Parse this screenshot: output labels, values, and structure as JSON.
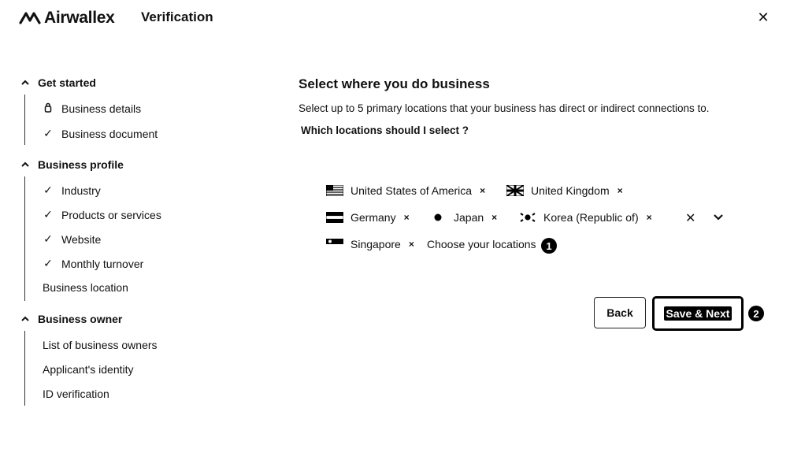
{
  "header": {
    "brand": "Airwallex",
    "title": "Verification",
    "close_icon": "close-icon"
  },
  "sidebar": {
    "sections": [
      {
        "title": "Get started",
        "items": [
          {
            "label": "Business details",
            "icon": "lock-icon"
          },
          {
            "label": "Business document",
            "icon": "check-icon"
          }
        ]
      },
      {
        "title": "Business profile",
        "items": [
          {
            "label": "Industry",
            "icon": "check-icon"
          },
          {
            "label": "Products or services",
            "icon": "check-icon"
          },
          {
            "label": "Website",
            "icon": "check-icon"
          },
          {
            "label": "Monthly turnover",
            "icon": "check-icon"
          },
          {
            "label": "Business location",
            "icon": ""
          }
        ]
      },
      {
        "title": "Business owner",
        "items": [
          {
            "label": "List of business owners",
            "icon": ""
          },
          {
            "label": "Applicant's identity",
            "icon": ""
          },
          {
            "label": "ID verification",
            "icon": ""
          }
        ]
      }
    ]
  },
  "main": {
    "title": "Select where you do business",
    "description": "Select up to 5 primary locations that your business has direct or indirect connections to.",
    "help_link": "Which locations should I select ?",
    "selected_locations": [
      {
        "label": "United States of America",
        "flag": "us-flag-icon"
      },
      {
        "label": "United Kingdom",
        "flag": "uk-flag-icon"
      },
      {
        "label": "Germany",
        "flag": "germany-flag-icon"
      },
      {
        "label": "Japan",
        "flag": "japan-flag-icon"
      },
      {
        "label": "Korea (Republic of)",
        "flag": "korea-flag-icon"
      },
      {
        "label": "Singapore",
        "flag": "singapore-flag-icon"
      }
    ],
    "remove_symbol": "×",
    "placeholder": "Choose your locations",
    "clear_symbol": "✕",
    "dropdown_symbol": "⌄",
    "back_label": "Back",
    "save_label": "Save & Next",
    "annotations": [
      "1",
      "2"
    ]
  }
}
